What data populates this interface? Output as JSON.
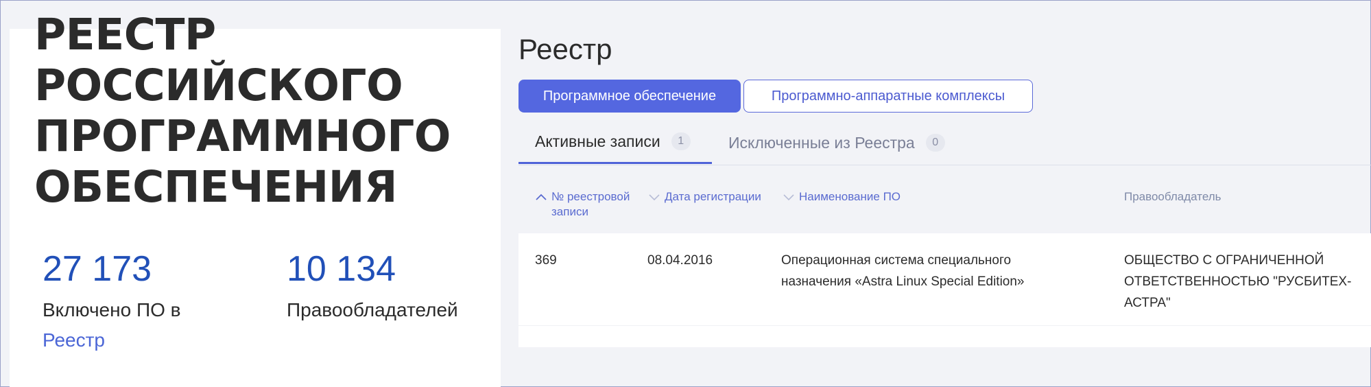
{
  "sidebar": {
    "title_lines": [
      "РЕЕСТР",
      "РОССИЙСКОГО",
      "ПРОГРАММНОГО",
      "ОБЕСПЕЧЕНИЯ"
    ],
    "stats": [
      {
        "value": "27 173",
        "label": "Включено ПО в",
        "link": "Реестр"
      },
      {
        "value": "10 134",
        "label": "Правообладателей"
      }
    ]
  },
  "main": {
    "title": "Реестр",
    "category_tabs": [
      {
        "label": "Программное обеспечение",
        "active": true
      },
      {
        "label": "Программно-аппаратные комплексы",
        "active": false
      }
    ],
    "record_tabs": [
      {
        "label": "Активные записи",
        "count": "1",
        "active": true
      },
      {
        "label": "Исключенные из Реестра",
        "count": "0",
        "active": false
      }
    ],
    "table": {
      "columns": [
        {
          "label_lines": [
            "№ реестровой",
            "записи"
          ],
          "sort_icon": "chevron-up-icon"
        },
        {
          "label_lines": [
            "Дата регистрации"
          ],
          "sort_icon": "chevron-down-icon"
        },
        {
          "label_lines": [
            "Наименование ПО"
          ],
          "sort_icon": "chevron-down-icon"
        },
        {
          "label_lines": [
            "Правообладатель"
          ],
          "sort_icon": null
        }
      ],
      "rows": [
        {
          "number": "369",
          "date": "08.04.2016",
          "name_lines": [
            "Операционная система специального",
            "назначения «Astra Linux Special Edition»"
          ],
          "holder_lines": [
            "ОБЩЕСТВО С ОГРАНИЧЕННОЙ",
            "ОТВЕТСТВЕННОСТЬЮ \"РУСБИТЕХ-",
            "АСТРА\""
          ]
        }
      ]
    }
  },
  "colors": {
    "accent": "#5467e0",
    "stat_number": "#2150b8",
    "link": "#4b66d6",
    "page_bg": "#f2f3f7"
  }
}
